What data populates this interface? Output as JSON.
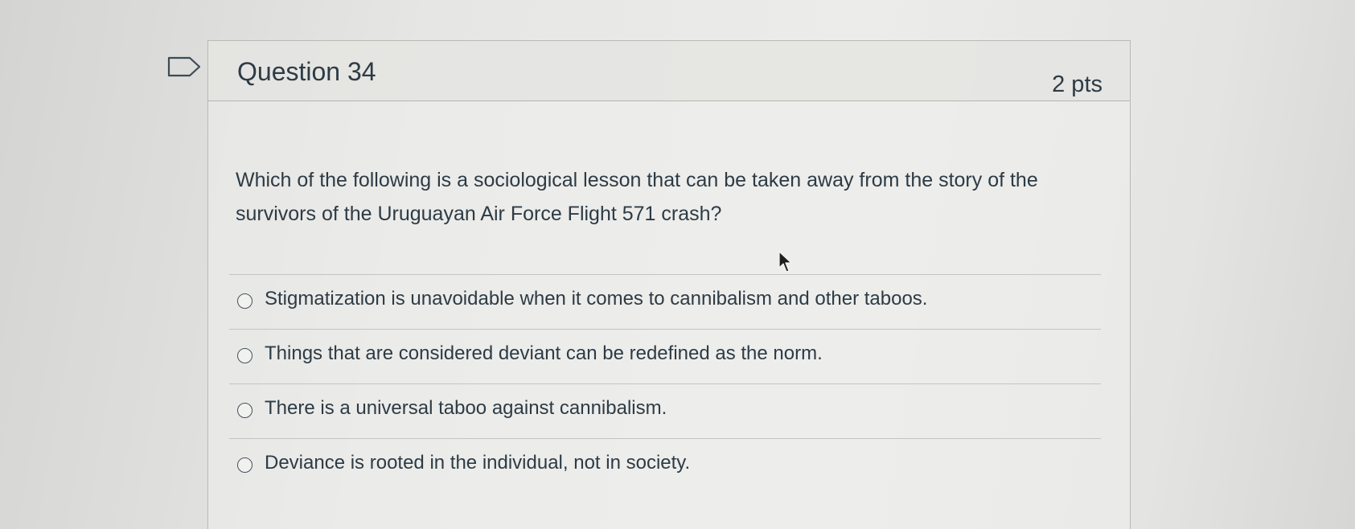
{
  "question": {
    "title": "Question 34",
    "points": "2 pts",
    "text": "Which of the following is a sociological lesson that can be taken away from the story of the survivors of the Uruguayan Air Force Flight 571 crash?",
    "answers": [
      {
        "label": "Stigmatization is unavoidable when it comes to cannibalism and other taboos.",
        "selected": false
      },
      {
        "label": "Things that are considered deviant can be redefined as the norm.",
        "selected": false
      },
      {
        "label": "There is a universal taboo against cannibalism.",
        "selected": false
      },
      {
        "label": "Deviance is rooted in the individual, not in society.",
        "selected": false
      }
    ]
  },
  "icons": {
    "flag": "flag-question-icon",
    "pointer": "mouse-pointer-icon"
  },
  "colors": {
    "text": "#2d3b45",
    "border": "#b9b9b7",
    "divider": "#c4c4c2"
  }
}
